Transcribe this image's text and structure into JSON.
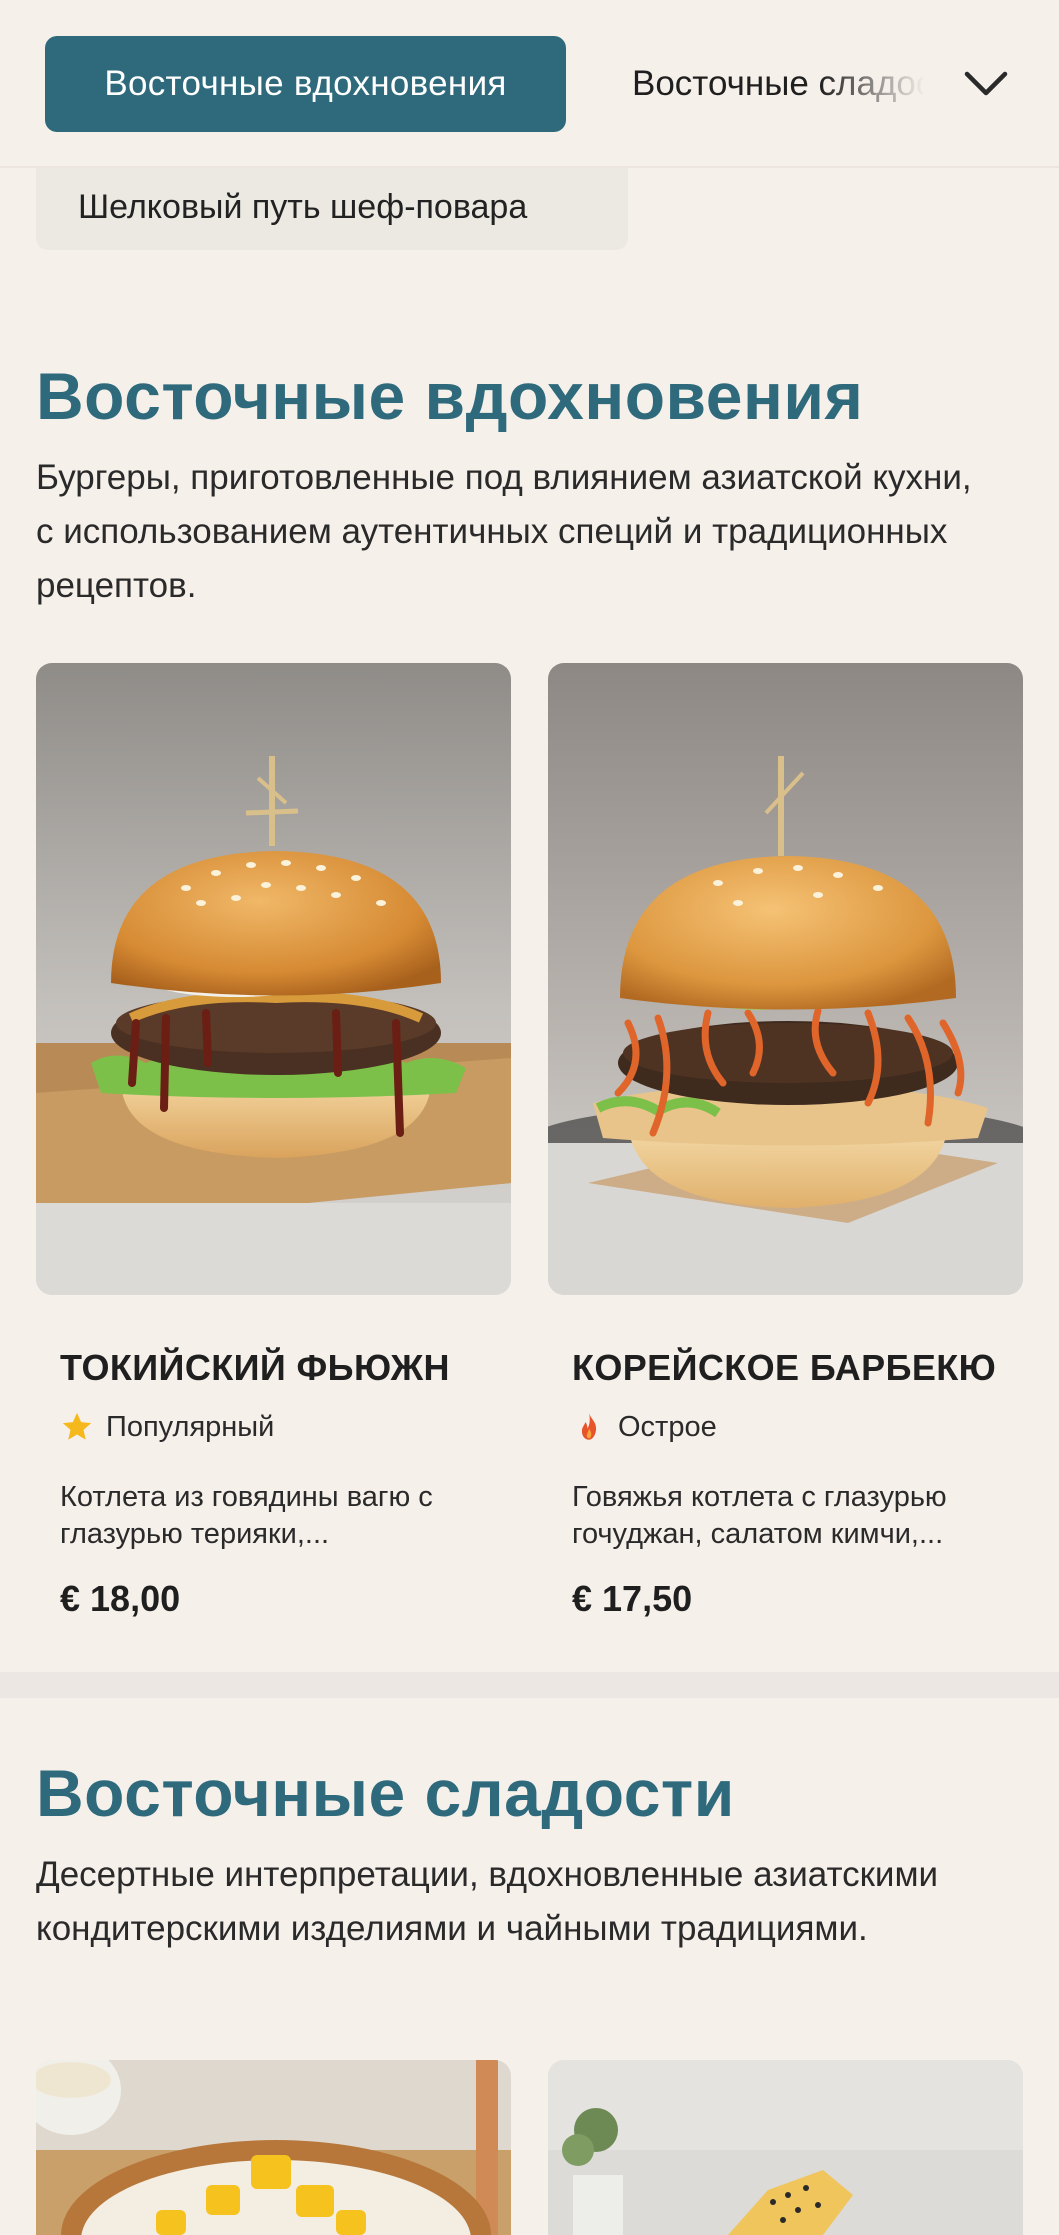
{
  "nav": {
    "active_tab": "Восточные вдохновения",
    "next_tab": "Восточные сладости",
    "filter_chip": "Шелковый путь шеф-повара"
  },
  "sections": [
    {
      "title": "Восточные вдохновения",
      "description": "Бургеры, приготовленные под влиянием азиатской кухни, с использованием аутентичных специй и традиционных рецептов.",
      "items": [
        {
          "name": "ТОКИЙСКИЙ ФЬЮЖН",
          "tag": "Популярный",
          "tag_icon": "star-icon",
          "description": "Котлета из говядины вагю с глазурью терияки,...",
          "price": "€ 18,00"
        },
        {
          "name": "КОРЕЙСКОЕ БАРБЕКЮ",
          "tag": "Острое",
          "tag_icon": "flame-icon",
          "description": "Говяжья котлета с глазурью гочуджан, салатом кимчи,...",
          "price": "€ 17,50"
        }
      ]
    },
    {
      "title": "Восточные сладости",
      "description": "Десертные интерпретации, вдохновленные азиатскими кондитерскими изделиями и чайными традициями."
    }
  ],
  "colors": {
    "accent": "#2e6a7c",
    "background": "#f6f0eb",
    "star": "#f5b91e",
    "flame": "#e8542a"
  }
}
